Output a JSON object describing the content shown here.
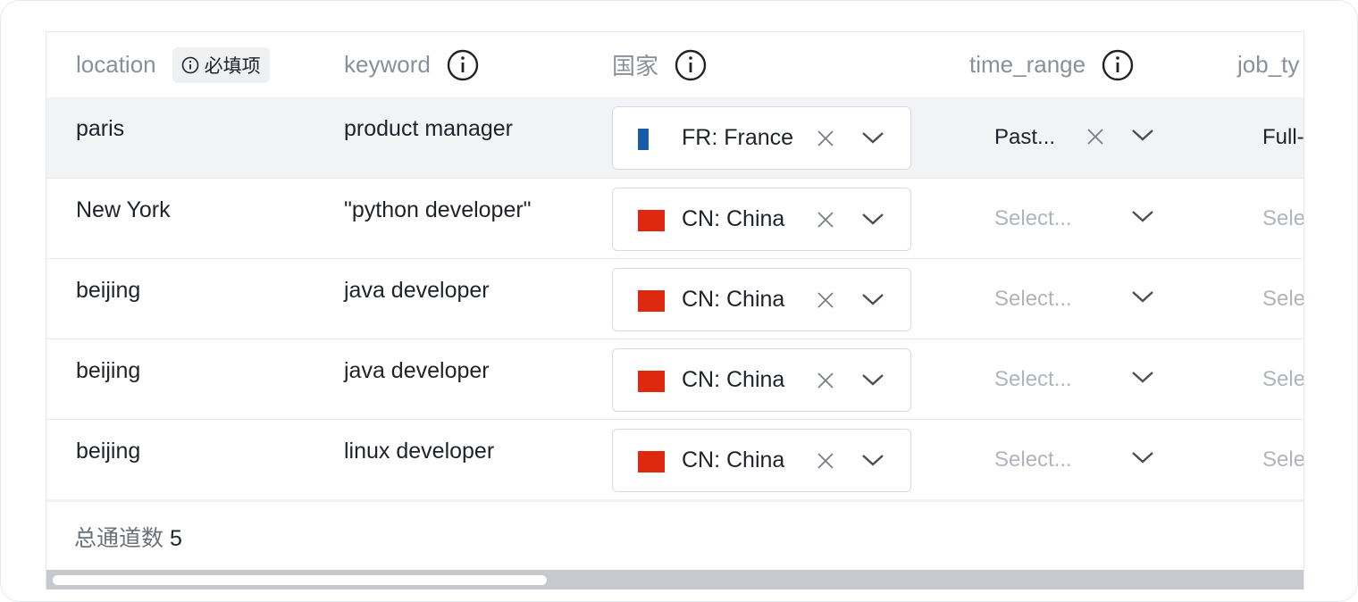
{
  "columns": {
    "location": "location",
    "required_badge": "必填项",
    "keyword": "keyword",
    "country": "国家",
    "time_range": "time_range",
    "job_type": "job_ty"
  },
  "rows": [
    {
      "location": "paris",
      "keyword": "product manager",
      "country": "FR: France",
      "country_code": "FR",
      "time_range": "Past...",
      "job_type": "Full-"
    },
    {
      "location": "New York",
      "keyword": "\"python developer\"",
      "country": "CN: China",
      "country_code": "CN",
      "time_range": "Select...",
      "job_type": "Sele"
    },
    {
      "location": "beijing",
      "keyword": "java developer",
      "country": "CN: China",
      "country_code": "CN",
      "time_range": "Select...",
      "job_type": "Sele"
    },
    {
      "location": "beijing",
      "keyword": "java developer",
      "country": "CN: China",
      "country_code": "CN",
      "time_range": "Select...",
      "job_type": "Sele"
    },
    {
      "location": "beijing",
      "keyword": "linux developer",
      "country": "CN: China",
      "country_code": "CN",
      "time_range": "Select...",
      "job_type": "Sele"
    }
  ],
  "footer": {
    "total_label": "总通道数",
    "total_count": "5"
  },
  "colors": {
    "france_flag": "#1a5ba6",
    "china_flag": "#de2910",
    "selected_row_bg": "#f2f3f5"
  }
}
